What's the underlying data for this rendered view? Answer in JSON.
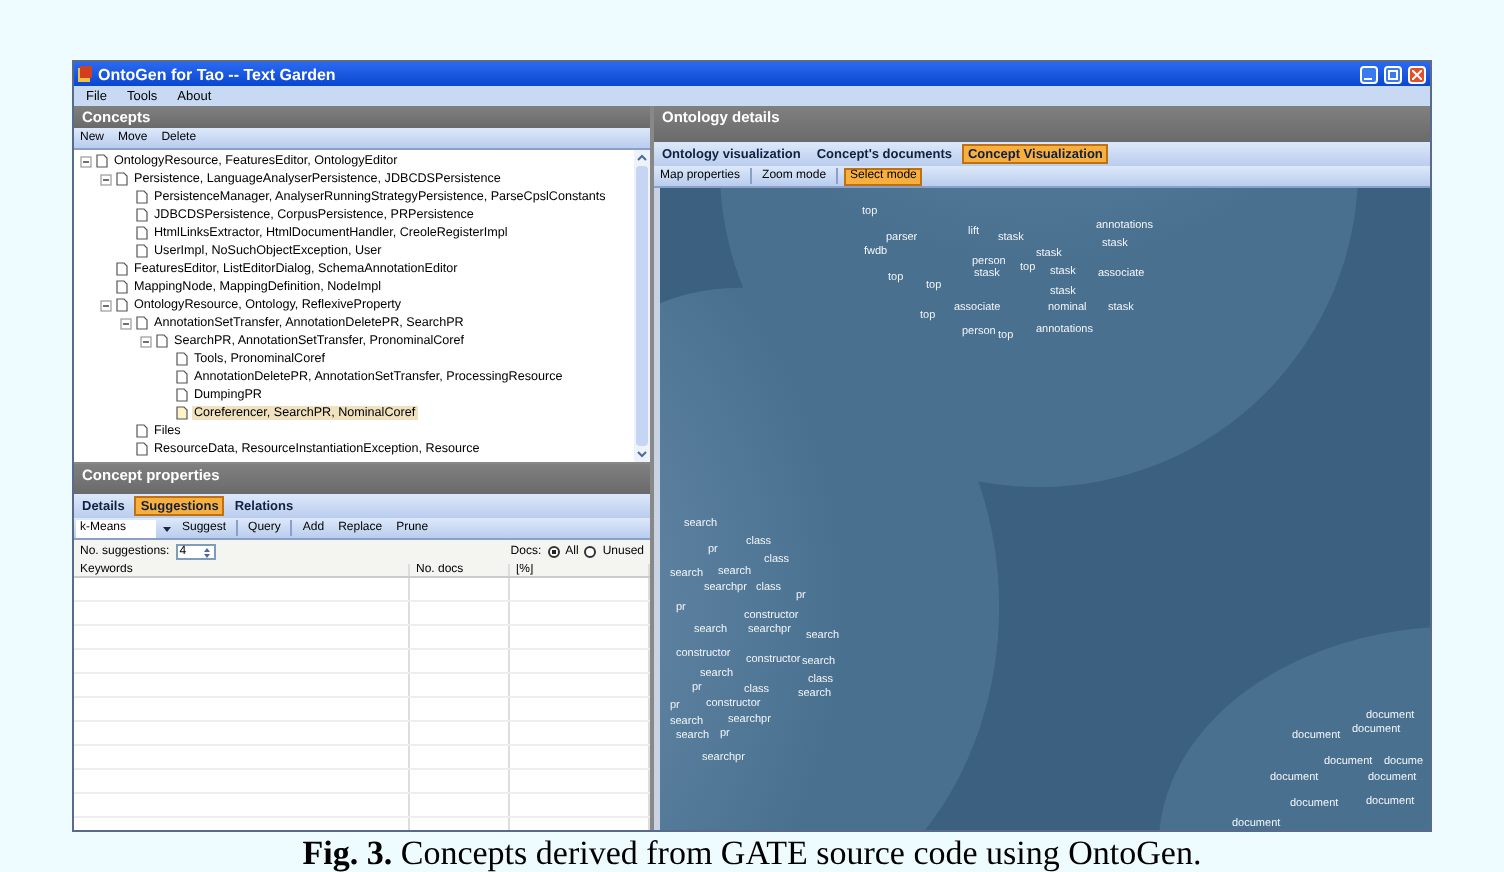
{
  "window": {
    "title": "OntoGen for Tao -- Text Garden"
  },
  "menu": [
    "File",
    "Tools",
    "About"
  ],
  "concepts": {
    "title": "Concepts",
    "toolbar": [
      "New",
      "Move",
      "Delete"
    ],
    "tree": [
      {
        "label": "OntologyResource, FeaturesEditor, OntologyEditor",
        "expanded": true,
        "selected": false,
        "children": [
          {
            "label": "Persistence, LanguageAnalyserPersistence, JDBCDSPersistence",
            "expanded": true,
            "selected": false,
            "children": [
              {
                "label": "PersistenceManager, AnalyserRunningStrategyPersistence, ParseCpslConstants",
                "selected": false
              },
              {
                "label": "JDBCDSPersistence, CorpusPersistence, PRPersistence",
                "selected": false
              },
              {
                "label": "HtmlLinksExtractor, HtmlDocumentHandler, CreoleRegisterImpl",
                "selected": false
              },
              {
                "label": "UserImpl, NoSuchObjectException, User",
                "selected": false
              }
            ]
          },
          {
            "label": "FeaturesEditor, ListEditorDialog, SchemaAnnotationEditor",
            "selected": false
          },
          {
            "label": "MappingNode, MappingDefinition, NodeImpl",
            "selected": false
          },
          {
            "label": "OntologyResource, Ontology, ReflexiveProperty",
            "expanded": true,
            "selected": false,
            "children": [
              {
                "label": "AnnotationSetTransfer, AnnotationDeletePR, SearchPR",
                "expanded": true,
                "selected": false,
                "children": [
                  {
                    "label": "SearchPR, AnnotationSetTransfer, PronominalCoref",
                    "expanded": true,
                    "selected": false,
                    "children": [
                      {
                        "label": "Tools, PronominalCoref",
                        "selected": false
                      },
                      {
                        "label": "AnnotationDeletePR, AnnotationSetTransfer, ProcessingResource",
                        "selected": false
                      },
                      {
                        "label": "DumpingPR",
                        "selected": false
                      },
                      {
                        "label": "Coreferencer, SearchPR, NominalCoref",
                        "selected": true
                      }
                    ]
                  }
                ]
              },
              {
                "label": "Files",
                "selected": false
              },
              {
                "label": "ResourceData, ResourceInstantiationException, Resource",
                "selected": false
              }
            ]
          }
        ]
      }
    ]
  },
  "properties": {
    "title": "Concept properties",
    "tabs": [
      {
        "label": "Details",
        "selected": false
      },
      {
        "label": "Suggestions",
        "selected": true
      },
      {
        "label": "Relations",
        "selected": false
      }
    ],
    "method": "k-Means",
    "toolbar": [
      "Suggest",
      "Query",
      "Add",
      "Replace",
      "Prune"
    ],
    "suggestions_label": "No. suggestions:",
    "suggestions_value": "4",
    "docs_label": "Docs:",
    "docs_options": [
      {
        "label": "All",
        "selected": true
      },
      {
        "label": "Unused",
        "selected": false
      }
    ],
    "columns": [
      "Keywords",
      "No. docs",
      "[%]"
    ]
  },
  "details": {
    "title": "Ontology details",
    "tabs": [
      {
        "label": "Ontology visualization",
        "selected": false
      },
      {
        "label": "Concept's documents",
        "selected": false
      },
      {
        "label": "Concept Visualization",
        "selected": true
      }
    ],
    "modes": [
      {
        "label": "Map properties",
        "selected": false
      },
      {
        "label": "Zoom mode",
        "selected": false
      },
      {
        "label": "Select mode",
        "selected": true
      }
    ],
    "clusters": [
      {
        "words": [
          "top",
          "parser",
          "fwdb",
          "lift",
          "stask",
          "annotations",
          "stask",
          "stask",
          "person",
          "stask",
          "top",
          "stask",
          "associate",
          "top",
          "top",
          "stask",
          "associate",
          "nominal",
          "stask",
          "top",
          "person",
          "top",
          "annotations"
        ]
      },
      {
        "words": [
          "search",
          "class",
          "pr",
          "class",
          "search",
          "search",
          "searchpr",
          "class",
          "pr",
          "pr",
          "constructor",
          "search",
          "searchpr",
          "search",
          "constructor",
          "constructor",
          "search",
          "search",
          "class",
          "pr",
          "class",
          "search",
          "pr",
          "constructor",
          "search",
          "searchpr",
          "search",
          "pr",
          "searchpr"
        ]
      },
      {
        "words": [
          "document",
          "document",
          "document",
          "document",
          "docume",
          "document",
          "document",
          "document",
          "document",
          "document"
        ]
      }
    ]
  },
  "caption": "**Fig. 3.** Concepts derived from GATE source code using OntoGen."
}
